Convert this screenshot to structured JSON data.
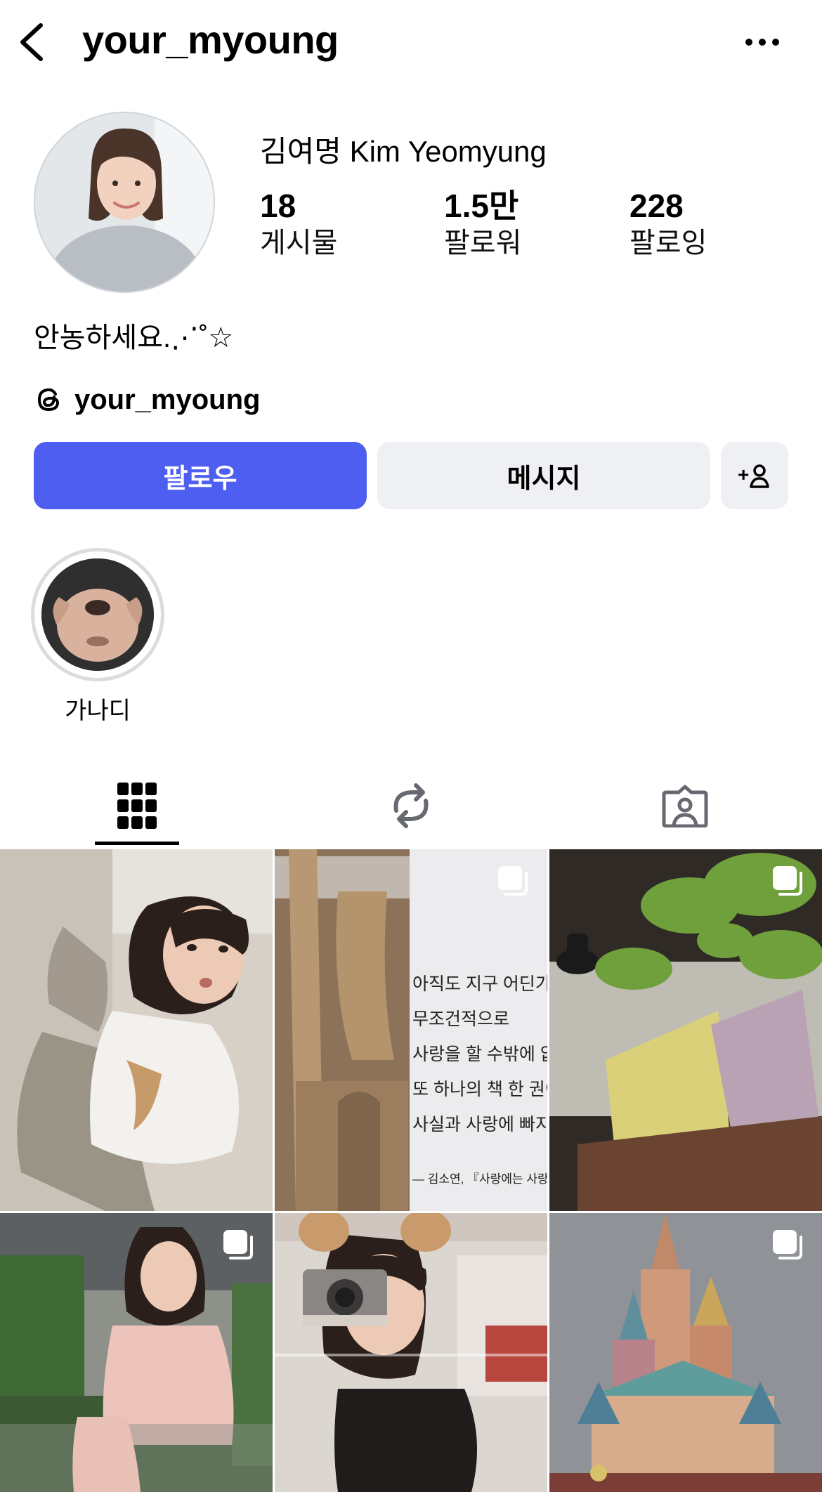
{
  "header": {
    "username": "your_myoung"
  },
  "profile": {
    "display_name": "김여명 Kim Yeomyung",
    "bio": "안농하세요.⋰˚☆",
    "threads_handle": "your_myoung"
  },
  "stats": [
    {
      "value": "18",
      "label": "게시물"
    },
    {
      "value": "1.5만",
      "label": "팔로워"
    },
    {
      "value": "228",
      "label": "팔로잉"
    }
  ],
  "buttons": {
    "follow": "팔로우",
    "message": "메시지",
    "add_user_symbol": "+"
  },
  "highlights": [
    {
      "label": "가나디"
    }
  ],
  "tabs": [
    {
      "icon": "grid-icon",
      "selected": true
    },
    {
      "icon": "reposts-icon",
      "selected": false
    },
    {
      "icon": "tagged-icon",
      "selected": false
    }
  ],
  "grid_posts": [
    {
      "id": "post-1",
      "multi": false
    },
    {
      "id": "post-2",
      "multi": true,
      "caption_lines": [
        "아직도 지구 어딘가에",
        "무조건적으로",
        "사랑을 할 수밖에 없는",
        "또 하나의 책 한 권이 있다",
        "사실과 사랑에 빠지게 되",
        "— 김소연, 『사랑에는 사랑이 없다』"
      ]
    },
    {
      "id": "post-3",
      "multi": true
    },
    {
      "id": "post-4",
      "multi": true
    },
    {
      "id": "post-5",
      "multi": false
    },
    {
      "id": "post-6",
      "multi": true
    }
  ],
  "colors": {
    "primary": "#4e5ef0",
    "button_gray": "#eff0f3",
    "text": "#000000"
  }
}
